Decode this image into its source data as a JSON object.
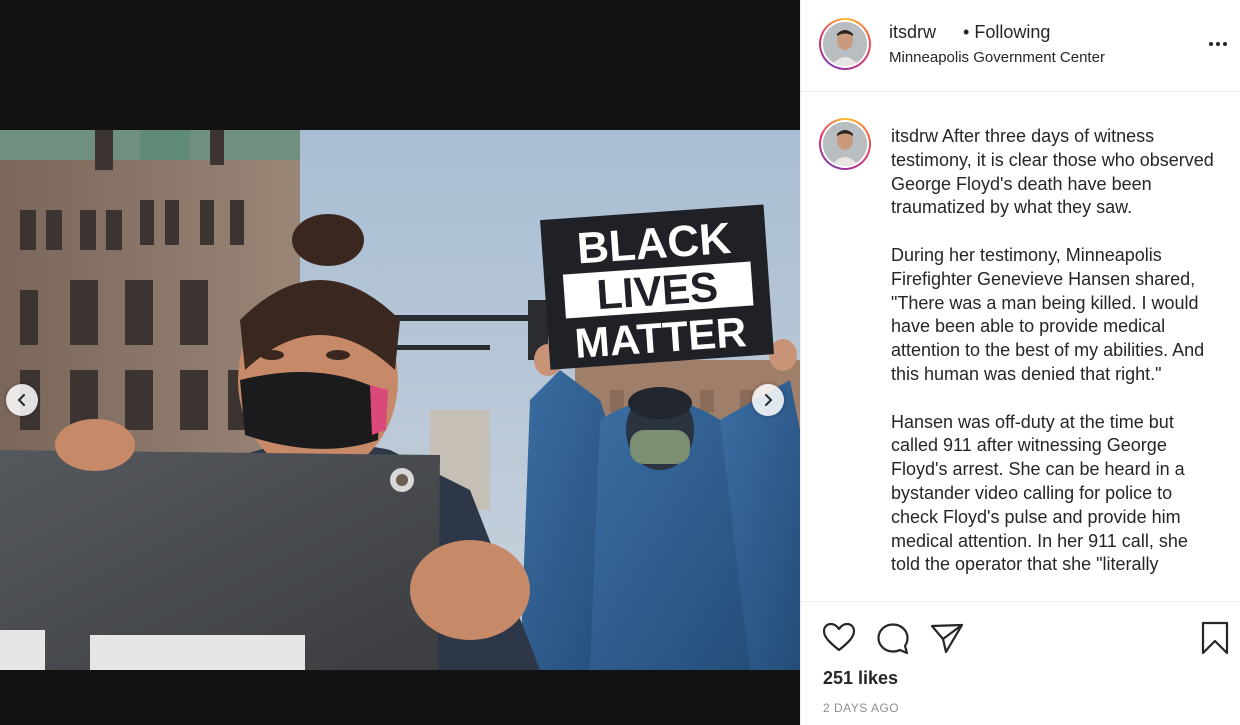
{
  "post": {
    "username": "itsdrw",
    "separator": "•",
    "follow_status": "Following",
    "location": "Minneapolis Government Center",
    "more_label": "More options",
    "caption_text": " After three days of witness testimony, it is clear those who observed George Floyd's death have been traumatized by what they saw.\n\nDuring her testimony, Minneapolis Firefighter Genevieve Hansen shared, \"There was a man being killed. I would have been able to provide medical attention to the best of my abilities. And this human was denied that right.\"\n\nHansen was off-duty at the time but called 911 after witnessing George Floyd's arrest. She can be heard in a bystander video calling for police to check Floyd's pulse and provide him medical attention. In her 911 call, she told the operator that she \"literally",
    "likes": "251 likes",
    "timestamp": "2 DAYS AGO"
  },
  "photo": {
    "sign_lines": [
      "BLACK",
      "LIVES",
      "MATTER"
    ],
    "colors": {
      "sky": "#b5c6d8",
      "building": "#8a7466",
      "sign_bg": "#1f2126",
      "banner": "#4a4c50",
      "denim": "#2f5d8c"
    }
  },
  "colors": {
    "panel_bg": "#ffffff",
    "text": "#262626",
    "muted": "#8e8e8e",
    "border": "#efefef",
    "media_bg": "#121212"
  }
}
